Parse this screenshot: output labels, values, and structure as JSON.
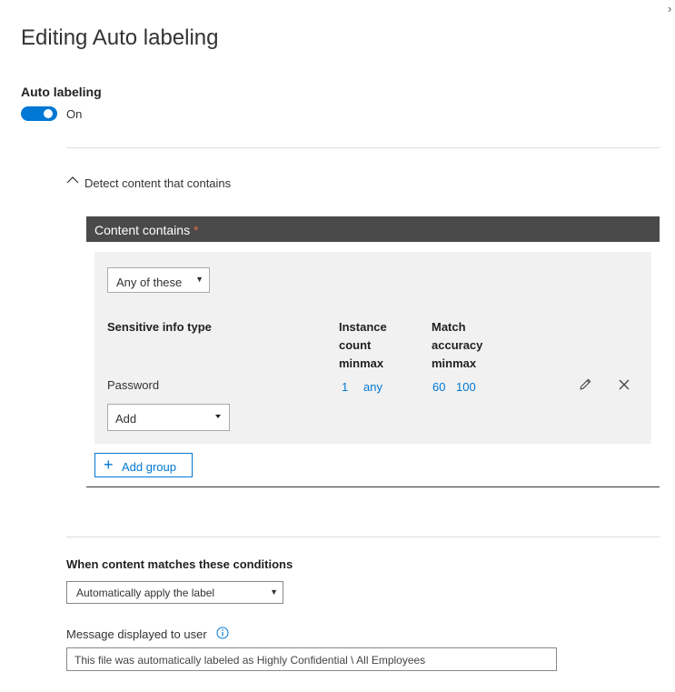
{
  "panel": {
    "title": "Editing Auto labeling",
    "close_glyph": "›"
  },
  "auto_labeling": {
    "heading": "Auto labeling",
    "toggle_state": "On",
    "enabled": true
  },
  "detect": {
    "section_label": "Detect content that contains",
    "expanded": true
  },
  "content_contains": {
    "title": "Content contains",
    "required_marker": "*",
    "group_operator": "Any of these",
    "columns": {
      "type": "Sensitive info type",
      "instance_count": "Instance count minmax",
      "match_accuracy": "Match accuracy minmax"
    },
    "rows": [
      {
        "type": "Password",
        "count_min": "1",
        "count_max": "any",
        "accuracy_min": "60",
        "accuracy_max": "100"
      }
    ],
    "add_select": "Add",
    "add_group_label": "Add group"
  },
  "conditions": {
    "label": "When content matches these conditions",
    "action": "Automatically apply the label"
  },
  "message": {
    "label": "Message displayed to user",
    "value": "This file was automatically labeled as Highly Confidential \\ All Employees"
  },
  "colors": {
    "accent": "#0078d4",
    "header_bg": "#4a4a4a",
    "group_bg": "#f1f1f1",
    "required": "#e06b3c"
  }
}
